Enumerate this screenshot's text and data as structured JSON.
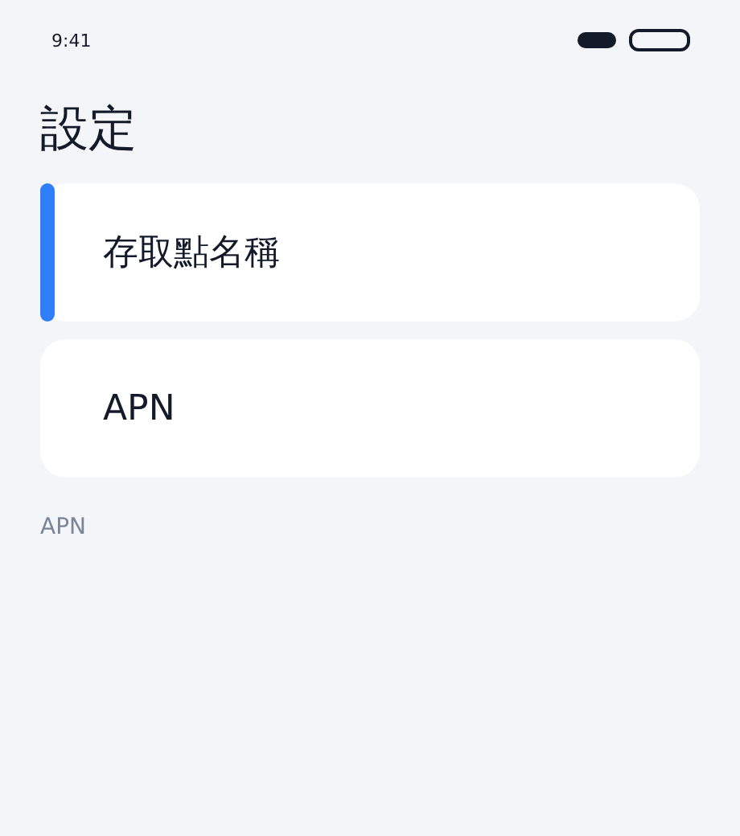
{
  "status_bar": {
    "time": "9:41"
  },
  "title": "設定",
  "items": [
    {
      "label": "存取點名稱",
      "selected": true
    },
    {
      "label": "APN",
      "selected": false
    }
  ],
  "footer": "APN"
}
